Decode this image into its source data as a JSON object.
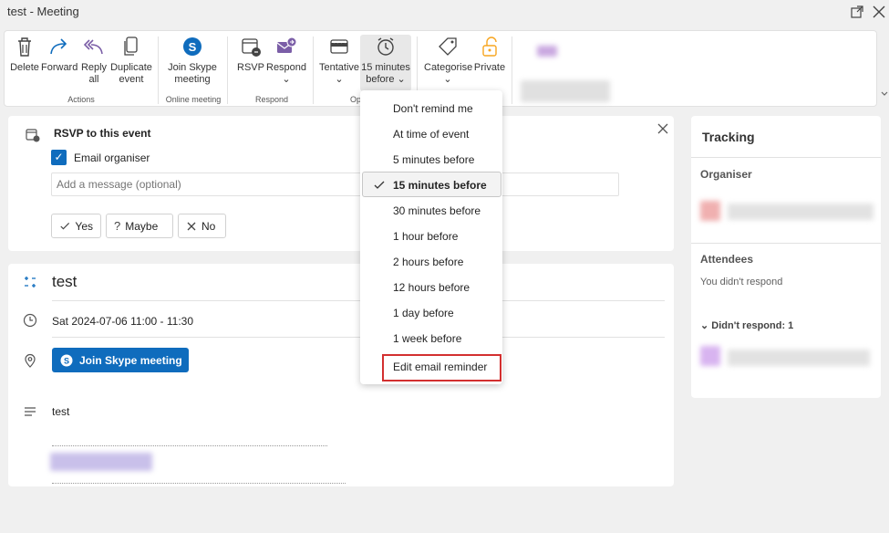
{
  "window": {
    "title": "test - Meeting"
  },
  "ribbon": {
    "delete": "Delete",
    "forward": "Forward",
    "reply_all": [
      "Reply",
      "all"
    ],
    "duplicate": [
      "Duplicate",
      "event"
    ],
    "actions_group": "Actions",
    "join_skype": [
      "Join Skype",
      "meeting"
    ],
    "online_group": "Online meeting",
    "rsvp": "RSVP",
    "respond": "Respond",
    "respond_group": "Respond",
    "tentative": "Tentative",
    "reminder": [
      "15 minutes",
      "before"
    ],
    "options_group": "Op",
    "categorise": "Categorise",
    "private": "Private",
    "colors": {
      "purple": "#7b5ea7",
      "skype": "#0f6cbd",
      "orange": "#f7a520"
    }
  },
  "rsvp": {
    "title": "RSVP to this event",
    "email_label": "Email organiser",
    "email_checked": true,
    "message_placeholder": "Add a message (optional)",
    "yes": "Yes",
    "maybe": "Maybe",
    "no": "No"
  },
  "event": {
    "title": "test",
    "datetime": "Sat 2024-07-06 11:00 - 11:30",
    "join_button": "Join Skype meeting",
    "body": "test"
  },
  "tracking": {
    "title": "Tracking",
    "organiser_label": "Organiser",
    "attendees_label": "Attendees",
    "no_response": "You didn't respond",
    "didnt_respond": "Didn't respond: 1"
  },
  "reminder_menu": {
    "items": [
      "Don't remind me",
      "At time of event",
      "5 minutes before",
      "15 minutes before",
      "30 minutes before",
      "1 hour before",
      "2 hours before",
      "12 hours before",
      "1 day before",
      "1 week before",
      "Edit email reminder"
    ],
    "selected": "15 minutes before",
    "highlight_color": "#d32f2f"
  }
}
